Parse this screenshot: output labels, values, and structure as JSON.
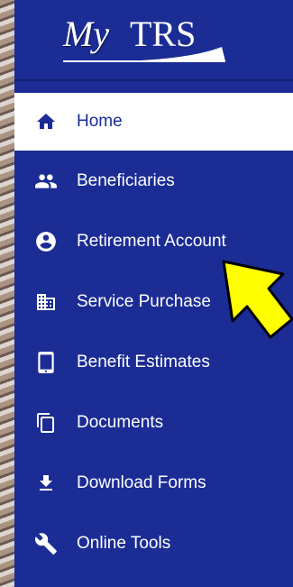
{
  "logo": {
    "prefix": "My",
    "name": "TRS"
  },
  "nav": {
    "items": [
      {
        "label": "Home",
        "icon": "home-icon",
        "active": true
      },
      {
        "label": "Beneficiaries",
        "icon": "people-icon"
      },
      {
        "label": "Retirement Account",
        "icon": "account-circle-icon"
      },
      {
        "label": "Service Purchase",
        "icon": "building-icon"
      },
      {
        "label": "Benefit Estimates",
        "icon": "tablet-icon"
      },
      {
        "label": "Documents",
        "icon": "documents-icon"
      },
      {
        "label": "Download Forms",
        "icon": "download-icon"
      },
      {
        "label": "Online Tools",
        "icon": "wrench-icon"
      }
    ]
  },
  "colors": {
    "sidebar": "#1b2c95",
    "active_bg": "#ffffff",
    "active_text": "#1b2c95",
    "pointer_arrow": "#ffff00"
  }
}
